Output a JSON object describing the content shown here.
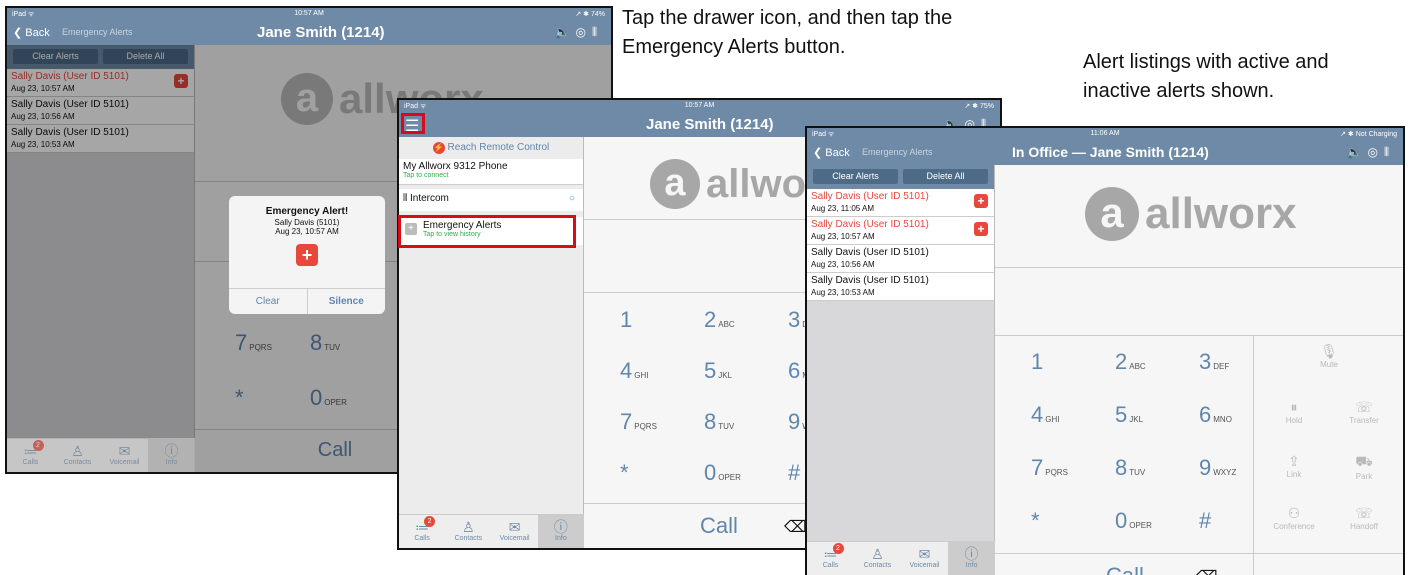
{
  "captions": {
    "c1": "Tap the drawer icon, and then tap the Emergency Alerts button.",
    "c2": "Alert listings with active and inactive alerts shown."
  },
  "shot1": {
    "status_left": "iPad ᯤ",
    "status_time": "10:57 AM",
    "status_right": "↗ ✱ 74%",
    "back": "Back",
    "back_sub": "Emergency Alerts",
    "title": "Jane Smith (1214)",
    "clear_alerts": "Clear Alerts",
    "delete_all": "Delete All",
    "alerts": [
      {
        "name": "Sally Davis (User ID 5101)",
        "time": "Aug 23, 10:57 AM",
        "active": true
      },
      {
        "name": "Sally Davis (User ID 5101)",
        "time": "Aug 23, 10:56 AM",
        "active": false
      },
      {
        "name": "Sally Davis (User ID 5101)",
        "time": "Aug 23, 10:53 AM",
        "active": false
      }
    ],
    "dialog": {
      "title": "Emergency Alert!",
      "line1": "Sally Davis (5101)",
      "line2": "Aug 23, 10:57 AM",
      "clear": "Clear",
      "silence": "Silence"
    },
    "keys": [
      {
        "n": "7",
        "s": "PQRS"
      },
      {
        "n": "8",
        "s": "TUV"
      },
      {
        "n": "*",
        "s": ""
      },
      {
        "n": "0",
        "s": "OPER"
      }
    ],
    "call": "Call"
  },
  "shot2": {
    "status_left": "iPad ᯤ",
    "status_time": "10:57 AM",
    "status_right": "↗ ✱ 75%",
    "title": "Jane Smith (1214)",
    "reach": "Reach Remote Control",
    "phone": "My Allworx 9312 Phone",
    "phone_sub": "Tap to connect",
    "intercom": "Intercom",
    "emergency": "Emergency Alerts",
    "emergency_sub": "Tap to view history",
    "keys": [
      {
        "n": "1",
        "s": ""
      },
      {
        "n": "2",
        "s": "ABC"
      },
      {
        "n": "3",
        "s": "DEF"
      },
      {
        "n": "4",
        "s": "GHI"
      },
      {
        "n": "5",
        "s": "JKL"
      },
      {
        "n": "6",
        "s": "MNO"
      },
      {
        "n": "7",
        "s": "PQRS"
      },
      {
        "n": "8",
        "s": "TUV"
      },
      {
        "n": "9",
        "s": "WXYZ"
      },
      {
        "n": "*",
        "s": ""
      },
      {
        "n": "0",
        "s": "OPER"
      },
      {
        "n": "#",
        "s": ""
      }
    ],
    "call": "Call"
  },
  "shot3": {
    "status_left": "iPad ᯤ",
    "status_time": "11:06 AM",
    "status_right": "↗ ✱ Not Charging",
    "back": "Back",
    "back_sub": "Emergency Alerts",
    "title": "In Office — Jane Smith (1214)",
    "clear_alerts": "Clear Alerts",
    "delete_all": "Delete All",
    "alerts": [
      {
        "name": "Sally Davis (User ID 5101)",
        "time": "Aug 23, 11:05 AM",
        "active": true
      },
      {
        "name": "Sally Davis (User ID 5101)",
        "time": "Aug 23, 10:57 AM",
        "active": true
      },
      {
        "name": "Sally Davis (User ID 5101)",
        "time": "Aug 23, 10:56 AM",
        "active": false
      },
      {
        "name": "Sally Davis (User ID 5101)",
        "time": "Aug 23, 10:53 AM",
        "active": false
      }
    ],
    "keys": [
      {
        "n": "1",
        "s": ""
      },
      {
        "n": "2",
        "s": "ABC"
      },
      {
        "n": "3",
        "s": "DEF"
      },
      {
        "n": "4",
        "s": "GHI"
      },
      {
        "n": "5",
        "s": "JKL"
      },
      {
        "n": "6",
        "s": "MNO"
      },
      {
        "n": "7",
        "s": "PQRS"
      },
      {
        "n": "8",
        "s": "TUV"
      },
      {
        "n": "9",
        "s": "WXYZ"
      },
      {
        "n": "*",
        "s": ""
      },
      {
        "n": "0",
        "s": "OPER"
      },
      {
        "n": "#",
        "s": ""
      }
    ],
    "call": "Call",
    "actions": [
      {
        "label": "Mute",
        "icon": "🎙"
      },
      {
        "label": "Hold",
        "icon": "⏸"
      },
      {
        "label": "Transfer",
        "icon": "☏"
      },
      {
        "label": "Link",
        "icon": "⇪"
      },
      {
        "label": "Park",
        "icon": "⛟"
      },
      {
        "label": "Conference",
        "icon": "⚇"
      },
      {
        "label": "Handoff",
        "icon": "☏"
      }
    ]
  },
  "logo_text": "allworx",
  "tabs": {
    "calls": "Calls",
    "contacts": "Contacts",
    "voicemail": "Voicemail",
    "info": "Info",
    "badge": "2"
  }
}
